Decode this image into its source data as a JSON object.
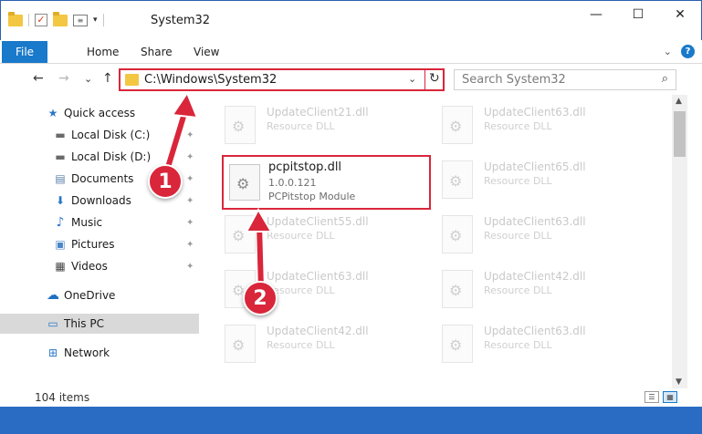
{
  "window": {
    "title": "System32",
    "minimize_glyph": "—",
    "maximize_glyph": "☐",
    "close_glyph": "✕"
  },
  "quick_access_toolbar": {
    "icons": [
      "folder-icon",
      "properties-check-icon",
      "folder-icon",
      "properties-icon"
    ],
    "dropdown_glyph": "▾"
  },
  "ribbon": {
    "tabs": [
      "File",
      "Home",
      "Share",
      "View"
    ],
    "expand_glyph": "⌄",
    "help_glyph": "?"
  },
  "navigation": {
    "back_glyph": "←",
    "forward_glyph": "→",
    "recent_glyph": "⌄",
    "up_glyph": "↑"
  },
  "address_bar": {
    "path": "C:\\Windows\\System32",
    "dropdown_glyph": "⌄",
    "refresh_glyph": "↻"
  },
  "search": {
    "placeholder": "Search System32",
    "icon_glyph": "⌕"
  },
  "sidebar": {
    "items": [
      {
        "label": "Quick access",
        "icon": "star-icon",
        "glyph": "★",
        "color": "#2b78c8",
        "pinned": false
      },
      {
        "label": "Local Disk (C:)",
        "icon": "drive-icon",
        "glyph": "▬",
        "color": "#6a6a6a",
        "pinned": true
      },
      {
        "label": "Local Disk (D:)",
        "icon": "drive-icon",
        "glyph": "▬",
        "color": "#6a6a6a",
        "pinned": true
      },
      {
        "label": "Documents",
        "icon": "documents-icon",
        "glyph": "▤",
        "color": "#5a7fa8",
        "pinned": true
      },
      {
        "label": "Downloads",
        "icon": "downloads-icon",
        "glyph": "⬇",
        "color": "#2b78c8",
        "pinned": true
      },
      {
        "label": "Music",
        "icon": "music-icon",
        "glyph": "♪",
        "color": "#2b78c8",
        "pinned": true
      },
      {
        "label": "Pictures",
        "icon": "pictures-icon",
        "glyph": "▣",
        "color": "#4a86c8",
        "pinned": true
      },
      {
        "label": "Videos",
        "icon": "videos-icon",
        "glyph": "▦",
        "color": "#444444",
        "pinned": true
      },
      {
        "label": "OneDrive",
        "icon": "cloud-icon",
        "glyph": "☁",
        "color": "#1f6fc2",
        "pinned": false
      },
      {
        "label": "This PC",
        "icon": "computer-icon",
        "glyph": "▭",
        "color": "#2b78c8",
        "pinned": false,
        "selected": true
      },
      {
        "label": "Network",
        "icon": "network-icon",
        "glyph": "⊞",
        "color": "#2b78c8",
        "pinned": false
      }
    ],
    "pin_glyph": "✦"
  },
  "files": {
    "left_column": [
      {
        "name": "UpdateClient21.dll",
        "desc": "Resource DLL"
      },
      {
        "name": "UpdateClient55.dll",
        "desc": "Resource DLL"
      },
      {
        "name": "UpdateClient63.dll",
        "desc": "Resource DLL"
      },
      {
        "name": "UpdateClient42.dll",
        "desc": "Resource DLL"
      }
    ],
    "right_column": [
      {
        "name": "UpdateClient63.dll",
        "desc": "Resource DLL"
      },
      {
        "name": "UpdateClient65.dll",
        "desc": "Resource DLL"
      },
      {
        "name": "UpdateClient63.dll",
        "desc": "Resource DLL"
      },
      {
        "name": "UpdateClient42.dll",
        "desc": "Resource DLL"
      },
      {
        "name": "UpdateClient63.dll",
        "desc": "Resource DLL"
      }
    ],
    "highlighted": {
      "name": "pcpitstop.dll",
      "version": "1.0.0.121",
      "desc": "PCPitstop Module"
    },
    "gear_glyph": "⚙"
  },
  "scrollbar": {
    "up_glyph": "▲",
    "down_glyph": "▼"
  },
  "status_bar": {
    "item_count": "104 items",
    "details_view_glyph": "☰",
    "tiles_view_glyph": "▦"
  },
  "annotations": {
    "step1": "1",
    "step2": "2",
    "color": "#d9263a"
  }
}
